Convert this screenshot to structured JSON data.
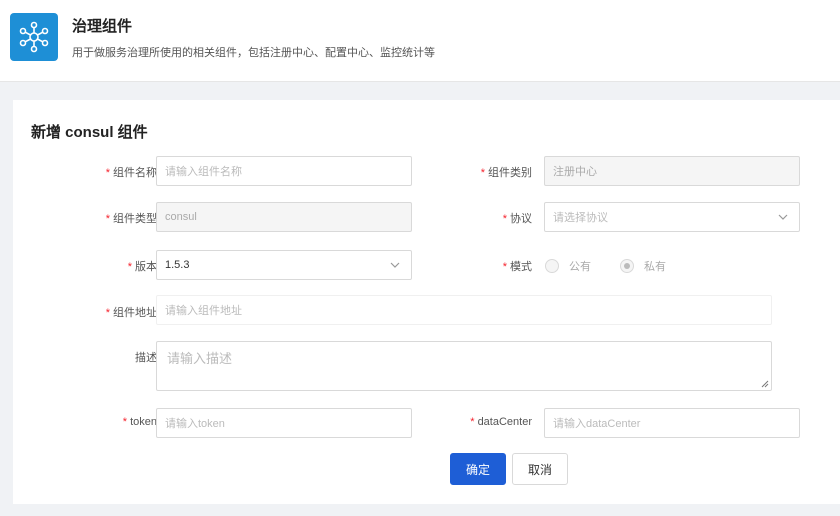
{
  "header": {
    "title": "治理组件",
    "description": "用于做服务治理所使用的相关组件，包括注册中心、配置中心、监控统计等",
    "icon": "network-nodes-icon",
    "icon_bg": "#1e8fd6"
  },
  "form": {
    "title": "新增 consul 组件",
    "fields": {
      "component_name": {
        "label": "组件名称",
        "placeholder": "请输入组件名称"
      },
      "component_category": {
        "label": "组件类别",
        "value": "注册中心"
      },
      "component_type": {
        "label": "组件类型",
        "value": "consul"
      },
      "protocol": {
        "label": "协议",
        "placeholder": "请选择协议"
      },
      "version": {
        "label": "版本",
        "value": "1.5.3"
      },
      "mode": {
        "label": "模式",
        "options": [
          "公有",
          "私有"
        ],
        "selected": "私有"
      },
      "component_address": {
        "label": "组件地址",
        "placeholder": "请输入组件地址"
      },
      "description": {
        "label": "描述",
        "placeholder": "请输入描述"
      },
      "token": {
        "label": "token",
        "placeholder": "请输入token"
      },
      "data_center": {
        "label": "dataCenter",
        "placeholder": "请输入dataCenter"
      }
    },
    "required_mark": "*",
    "confirm_label": "确定",
    "cancel_label": "取消"
  },
  "colors": {
    "primary": "#1e5ed6",
    "required": "#f5222d"
  }
}
